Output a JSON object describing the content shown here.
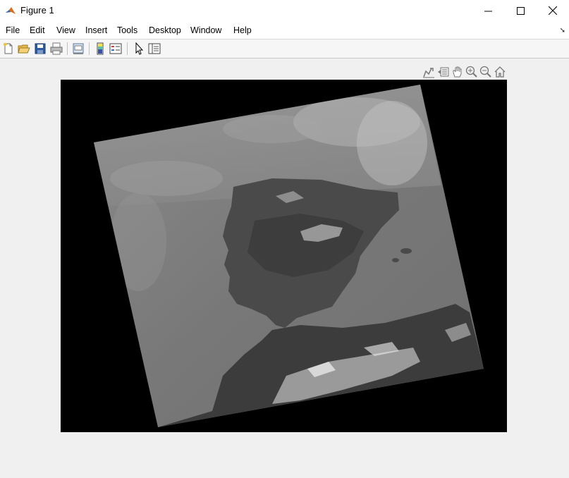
{
  "window": {
    "title": "Figure 1",
    "icon": "matlab-icon",
    "controls": [
      "minimize-icon",
      "maximize-icon",
      "close-icon"
    ]
  },
  "menu": {
    "items": [
      "File",
      "Edit",
      "View",
      "Insert",
      "Tools",
      "Desktop",
      "Window",
      "Help"
    ],
    "collapse_glyph": "➘"
  },
  "toolbar": {
    "buttons": [
      "new-figure-icon",
      "open-file-icon",
      "save-icon",
      "print-icon",
      "print-preview-icon",
      "colorbar-icon",
      "legend-icon",
      "edit-plot-icon",
      "property-editor-icon"
    ]
  },
  "axes_toolbar": {
    "buttons": [
      "export-icon",
      "brush-icon",
      "pan-icon",
      "zoom-in-icon",
      "zoom-out-icon",
      "home-icon"
    ]
  },
  "figure": {
    "content": "satellite-image",
    "background": "#000000",
    "colormap": "gray"
  }
}
